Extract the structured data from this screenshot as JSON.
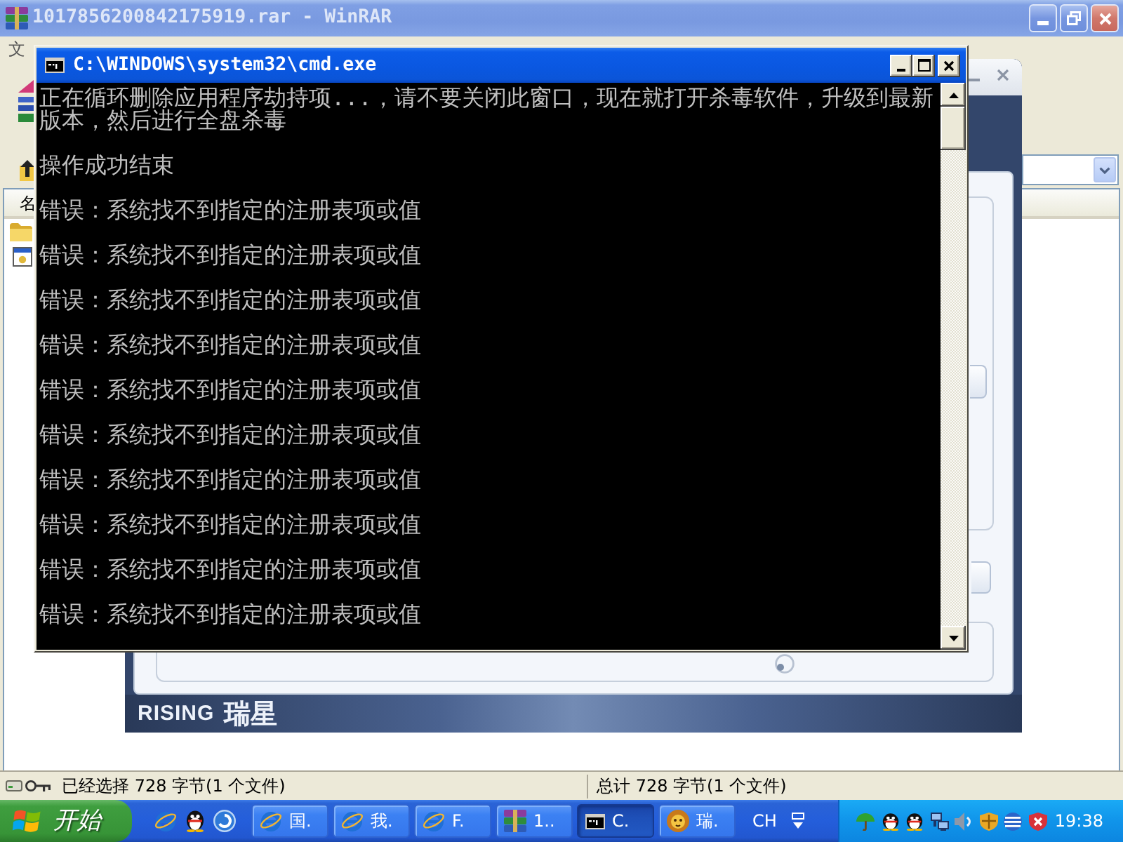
{
  "winrar_window": {
    "title": "1017856200842175919.rar - WinRAR",
    "active": false,
    "menu": [
      "文"
    ],
    "file_list": {
      "columns": [
        "名"
      ]
    },
    "status_bar": {
      "selection": "已经选择 728 字节(1 个文件)",
      "total": "总计 728 字节(1 个文件)"
    }
  },
  "rising_window": {
    "logo": {
      "latin": "RISING",
      "chinese": "瑞星"
    }
  },
  "cmd_window": {
    "title": "C:\\WINDOWS\\system32\\cmd.exe",
    "active": true,
    "output": [
      {
        "lines": [
          "正在循环删除应用程序劫持项...，请不要关闭此窗口，现在就打开杀毒软件，升级到最新",
          "版本，然后进行全盘杀毒"
        ]
      },
      {
        "lines": [
          "操作成功结束"
        ]
      },
      {
        "lines": [
          "错误：系统找不到指定的注册表项或值"
        ]
      },
      {
        "lines": [
          "错误：系统找不到指定的注册表项或值"
        ]
      },
      {
        "lines": [
          "错误：系统找不到指定的注册表项或值"
        ]
      },
      {
        "lines": [
          "错误：系统找不到指定的注册表项或值"
        ]
      },
      {
        "lines": [
          "错误：系统找不到指定的注册表项或值"
        ]
      },
      {
        "lines": [
          "错误：系统找不到指定的注册表项或值"
        ]
      },
      {
        "lines": [
          "错误：系统找不到指定的注册表项或值"
        ]
      },
      {
        "lines": [
          "错误：系统找不到指定的注册表项或值"
        ]
      },
      {
        "lines": [
          "错误：系统找不到指定的注册表项或值"
        ]
      },
      {
        "lines": [
          "错误：系统找不到指定的注册表项或值"
        ]
      }
    ]
  },
  "taskbar": {
    "start": "开始",
    "tasks": [
      {
        "label": "国.",
        "kind": "browser",
        "selected": false
      },
      {
        "label": "我.",
        "kind": "browser",
        "selected": false
      },
      {
        "label": "F.",
        "kind": "browser",
        "selected": false
      },
      {
        "label": "1..",
        "kind": "archiver",
        "selected": false
      },
      {
        "label": "C.",
        "kind": "console",
        "selected": true
      },
      {
        "label": "瑞.",
        "kind": "antivirus",
        "selected": false
      }
    ],
    "language": "CH",
    "clock": "19:38"
  }
}
